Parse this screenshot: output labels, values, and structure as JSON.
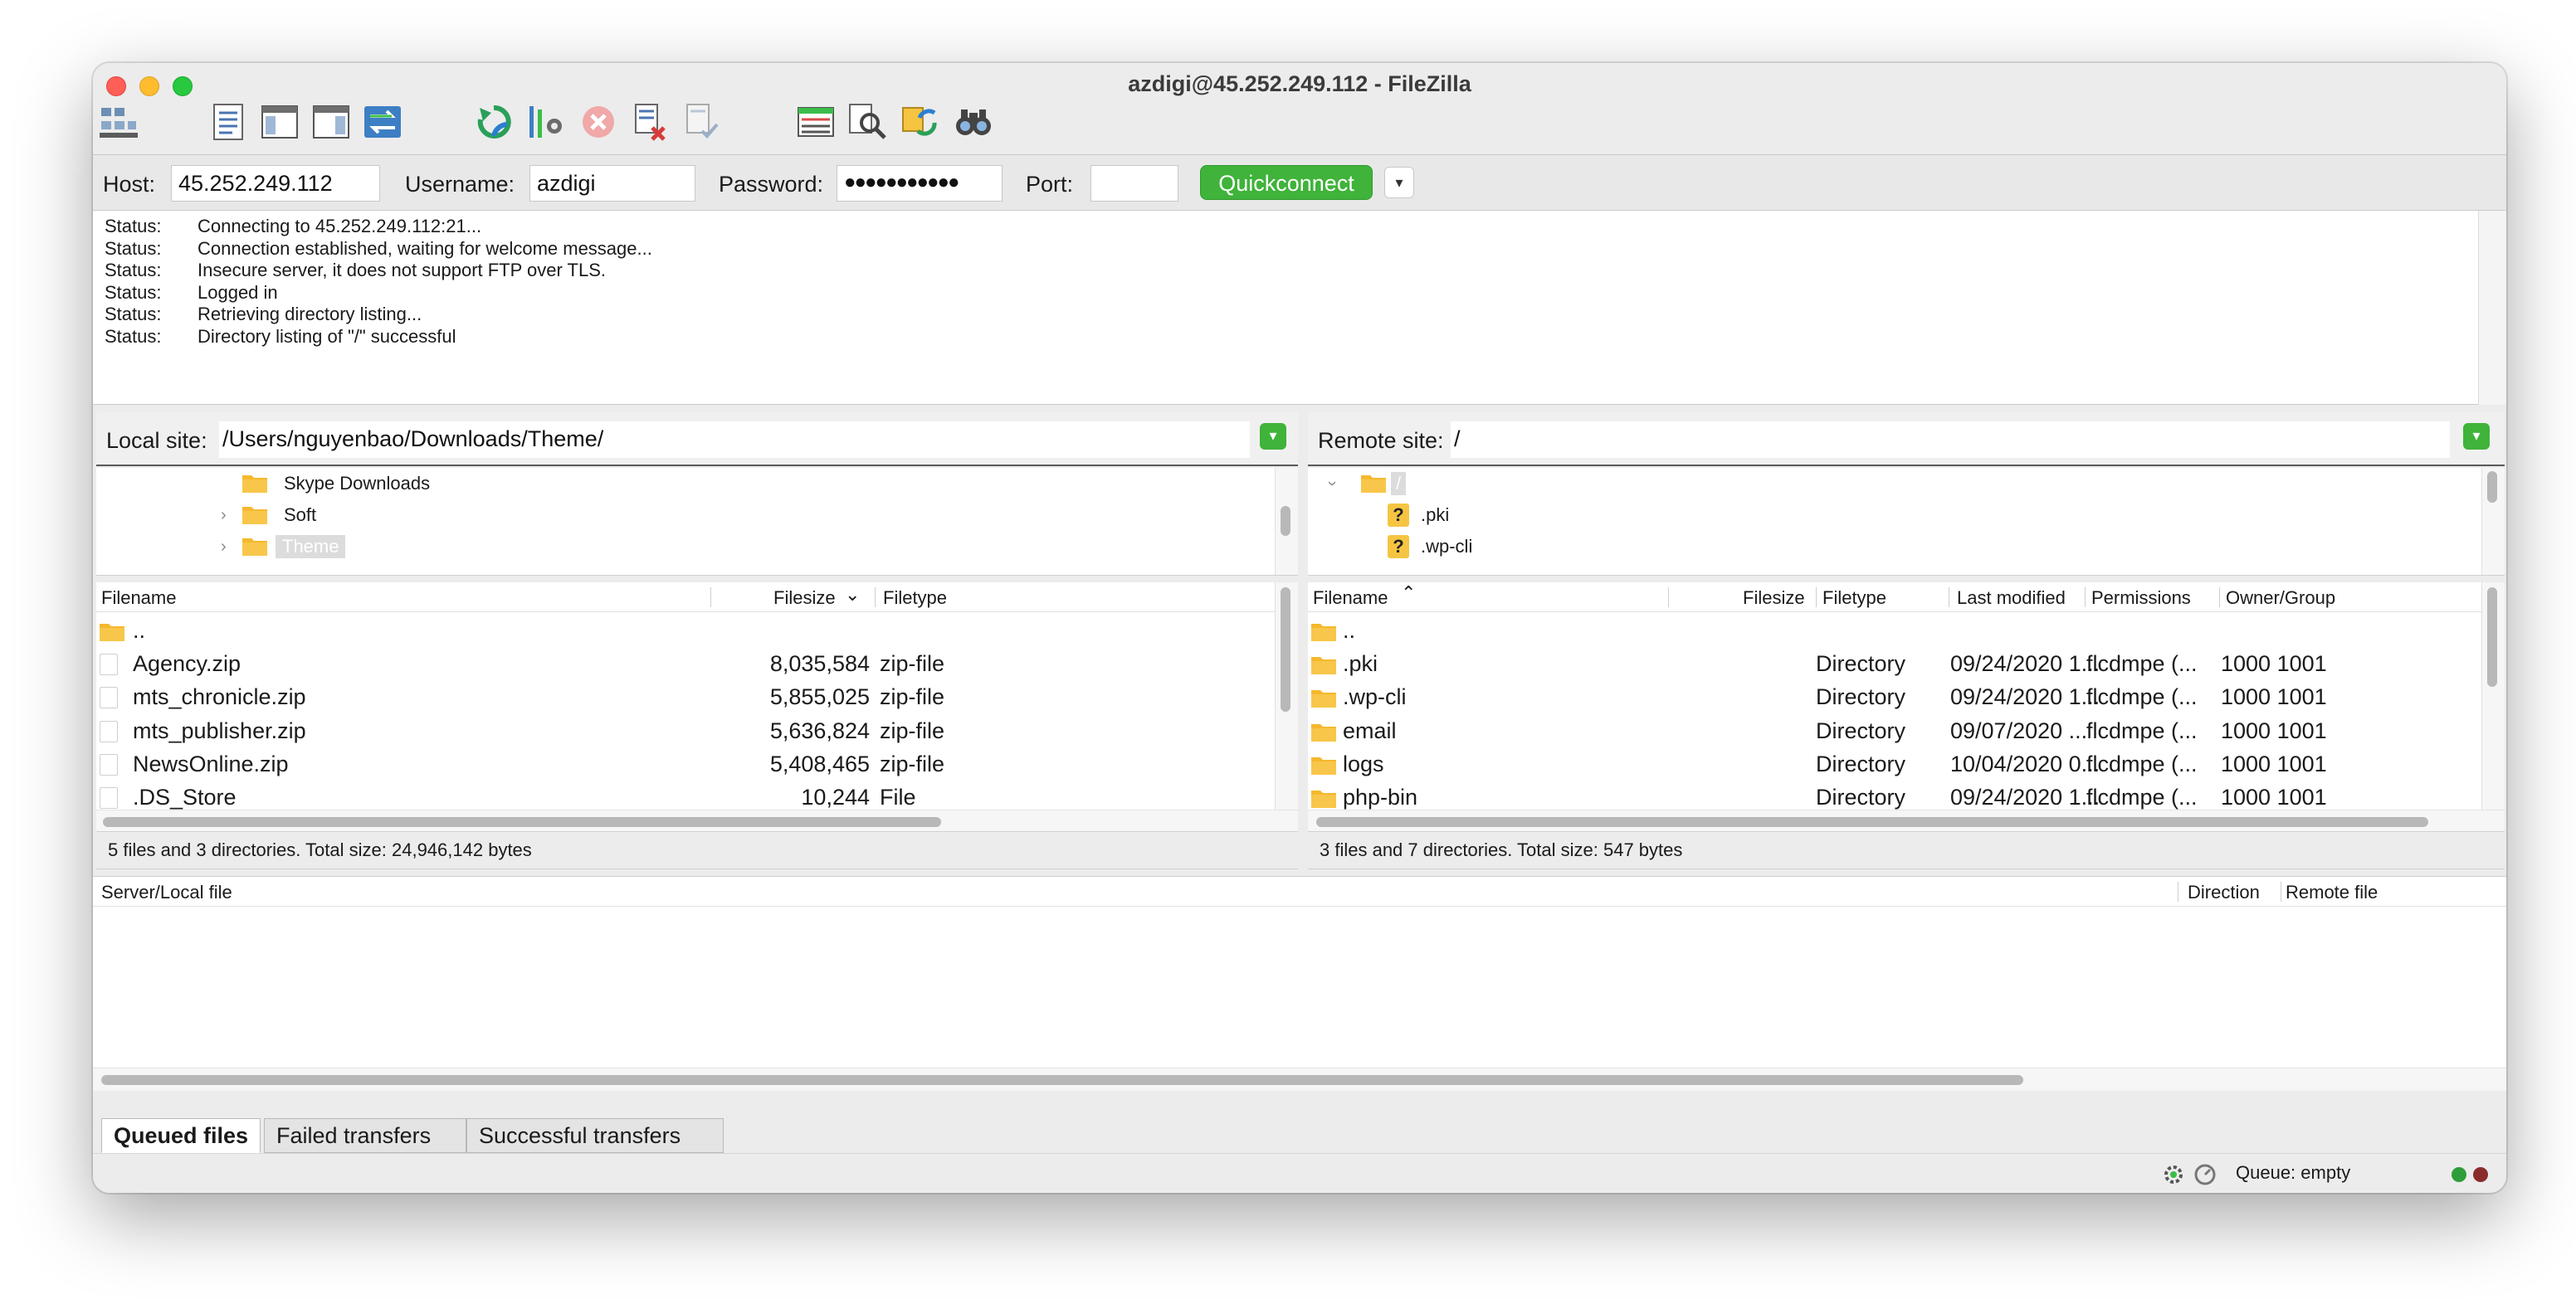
{
  "window": {
    "title": "azdigi@45.252.249.112 - FileZilla"
  },
  "colors": {
    "accent_green": "#3fb33a",
    "folder_yellow": "#f5b82e",
    "selected_bg": "#dcdcdc"
  },
  "toolbar": {
    "icons": [
      "site-manager-icon",
      "message-log-icon",
      "local-tree-icon",
      "remote-tree-icon",
      "transfer-queue-icon",
      "refresh-icon",
      "process-queue-icon",
      "cancel-icon",
      "disconnect-icon",
      "reconnect-icon",
      "directory-listing-filter-icon",
      "compare-directories-icon",
      "sync-browsing-icon",
      "search-files-icon"
    ]
  },
  "quickconnect": {
    "host_label": "Host:",
    "host_value": "45.252.249.112",
    "username_label": "Username:",
    "username_value": "azdigi",
    "password_label": "Password:",
    "password_value": "●●●●●●●●●●●",
    "port_label": "Port:",
    "port_value": "",
    "button_label": "Quickconnect",
    "dropdown_glyph": "▾"
  },
  "log": [
    {
      "key": "Status:",
      "value": "Connecting to 45.252.249.112:21..."
    },
    {
      "key": "Status:",
      "value": "Connection established, waiting for welcome message..."
    },
    {
      "key": "Status:",
      "value": "Insecure server, it does not support FTP over TLS."
    },
    {
      "key": "Status:",
      "value": "Logged in"
    },
    {
      "key": "Status:",
      "value": "Retrieving directory listing..."
    },
    {
      "key": "Status:",
      "value": "Directory listing of \"/\" successful"
    }
  ],
  "local": {
    "site_label": "Local site:",
    "site_path": "/Users/nguyenbao/Downloads/Theme/",
    "tree": [
      {
        "label": "Skype Downloads"
      },
      {
        "label": "Soft"
      },
      {
        "label": "Theme"
      }
    ],
    "columns": {
      "filename": "Filename",
      "filesize": "Filesize",
      "filetype": "Filetype"
    },
    "files": [
      {
        "name": "..",
        "size": "",
        "type": ""
      },
      {
        "name": "Agency.zip",
        "size": "8,035,584",
        "type": "zip-file"
      },
      {
        "name": "mts_chronicle.zip",
        "size": "5,855,025",
        "type": "zip-file"
      },
      {
        "name": "mts_publisher.zip",
        "size": "5,636,824",
        "type": "zip-file"
      },
      {
        "name": "NewsOnline.zip",
        "size": "5,408,465",
        "type": "zip-file"
      },
      {
        "name": ".DS_Store",
        "size": "10,244",
        "type": "File"
      }
    ],
    "status": "5 files and 3 directories. Total size: 24,946,142 bytes"
  },
  "remote": {
    "site_label": "Remote site:",
    "site_path": "/",
    "tree": [
      {
        "label": "/"
      },
      {
        "label": ".pki"
      },
      {
        "label": ".wp-cli"
      }
    ],
    "columns": {
      "filename": "Filename",
      "filesize": "Filesize",
      "filetype": "Filetype",
      "modified": "Last modified",
      "permissions": "Permissions",
      "owner": "Owner/Group"
    },
    "files": [
      {
        "name": "..",
        "size": "",
        "type": "",
        "modified": "",
        "perms": "",
        "owner": ""
      },
      {
        "name": ".pki",
        "size": "",
        "type": "Directory",
        "modified": "09/24/2020 1...",
        "perms": "flcdmpe (...",
        "owner": "1000 1001"
      },
      {
        "name": ".wp-cli",
        "size": "",
        "type": "Directory",
        "modified": "09/24/2020 1...",
        "perms": "flcdmpe (...",
        "owner": "1000 1001"
      },
      {
        "name": "email",
        "size": "",
        "type": "Directory",
        "modified": "09/07/2020 ...",
        "perms": "flcdmpe (...",
        "owner": "1000 1001"
      },
      {
        "name": "logs",
        "size": "",
        "type": "Directory",
        "modified": "10/04/2020 0...",
        "perms": "flcdmpe (...",
        "owner": "1000 1001"
      },
      {
        "name": "php-bin",
        "size": "",
        "type": "Directory",
        "modified": "09/24/2020 1...",
        "perms": "flcdmpe (...",
        "owner": "1000 1001"
      }
    ],
    "status": "3 files and 7 directories. Total size: 547 bytes"
  },
  "queue": {
    "columns": {
      "server_local": "Server/Local file",
      "direction": "Direction",
      "remote_file": "Remote file"
    },
    "tabs": [
      "Queued files",
      "Failed transfers",
      "Successful transfers"
    ],
    "status": "Queue: empty"
  }
}
